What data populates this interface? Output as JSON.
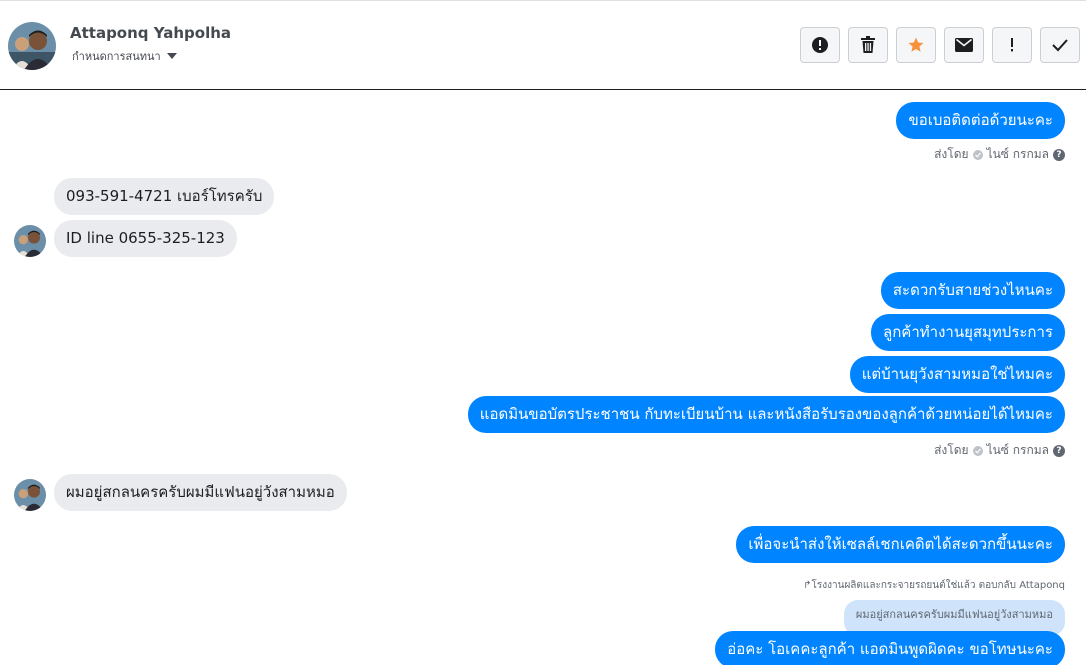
{
  "header": {
    "contact_name": "Attaponq Yahpolha",
    "conversation_menu_label": "กำหนดการสนทนา"
  },
  "toolbar": {
    "buttons": [
      {
        "icon": "alert-circle-icon"
      },
      {
        "icon": "trash-icon"
      },
      {
        "icon": "star-icon",
        "color": "#f7923b"
      },
      {
        "icon": "envelope-icon"
      },
      {
        "icon": "exclamation-icon"
      },
      {
        "icon": "checkmark-icon"
      }
    ]
  },
  "colors": {
    "outgoing_bubble": "#0084ff",
    "incoming_bubble": "#e9ebee",
    "quoted_bubble": "#cfe4fb",
    "star": "#f7923b"
  },
  "messages": [
    {
      "direction": "out",
      "text": "ขอเบอติดต่อด้วยนะคะ"
    },
    {
      "type": "sent_by",
      "text": "ส่งโดย",
      "sender": "ไนซ์ กรกมล"
    },
    {
      "direction": "in",
      "text": "093-591-4721 เบอร์โทรครับ"
    },
    {
      "direction": "in",
      "text": "ID line 0655-325-123"
    },
    {
      "direction": "out",
      "text": "สะดวกรับสายช่วงไหนคะ"
    },
    {
      "direction": "out",
      "text": "ลูกค้าทำงานยุสมุทประการ"
    },
    {
      "direction": "out",
      "text": "แต่บ้านยุวังสามหมอใช่ไหมคะ"
    },
    {
      "direction": "out",
      "text": "แอดมินขอบัตรประชาชน กับทะเบียนบ้าน และหนังสือรับรองของลูกค้าด้วยหน่อยได้ไหมคะ"
    },
    {
      "type": "sent_by",
      "text": "ส่งโดย",
      "sender": "ไนซ์ กรกมล"
    },
    {
      "direction": "in",
      "text": "ผมอยู่สกลนครครับผมมีแฟนอยู่วังสามหมอ"
    },
    {
      "direction": "out",
      "text": "เพื่อจะนำส่งให้เซลล์เชกเคดิตได้สะดวกขึ้นนะคะ"
    },
    {
      "type": "reply_note",
      "text": "โรงงานผลิตและกระจายรถยนต์ใช่แล้ว ตอบกลับ Attaponq"
    },
    {
      "type": "quoted",
      "text": "ผมอยู่สกลนครครับผมมีแฟนอยู่วังสามหมอ"
    },
    {
      "direction": "out",
      "text": "อ่อคะ โอเคคะลูกค้า แอดมินพูดผิดคะ ขอโทษนะคะ"
    }
  ]
}
